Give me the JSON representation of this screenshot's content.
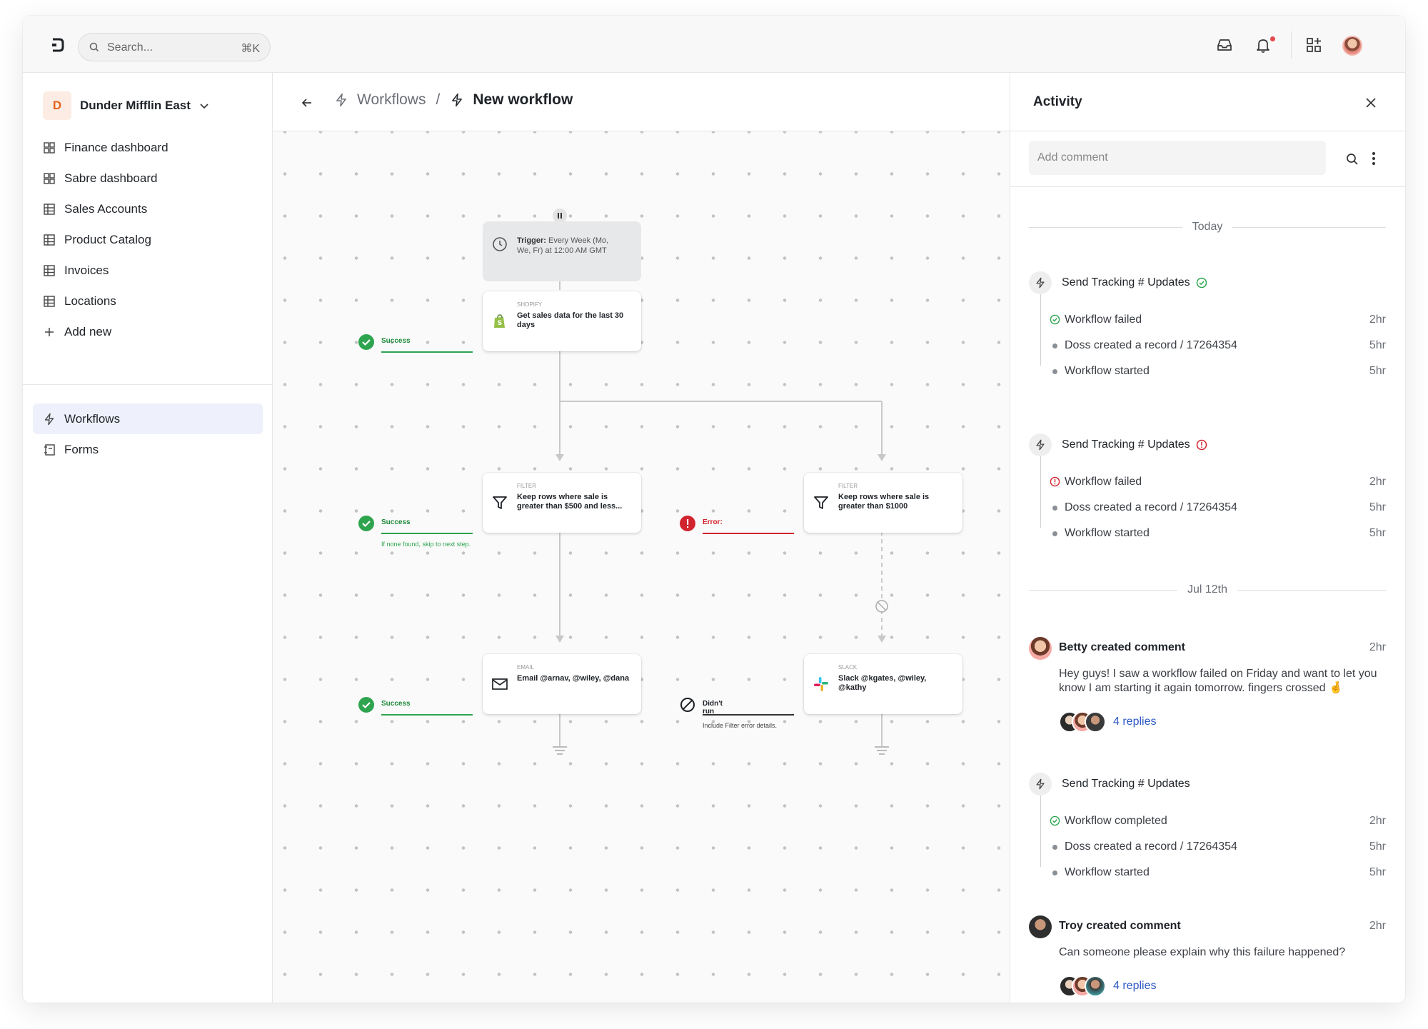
{
  "topbar": {
    "search_placeholder": "Search...",
    "search_shortcut": "⌘K"
  },
  "sidebar": {
    "org_initial": "D",
    "org_name": "Dunder Mifflin East",
    "items": [
      {
        "label": "Finance dashboard",
        "icon": "dashboard-icon"
      },
      {
        "label": "Sabre dashboard",
        "icon": "dashboard-icon"
      },
      {
        "label": "Sales Accounts",
        "icon": "table-icon"
      },
      {
        "label": "Product Catalog",
        "icon": "table-icon"
      },
      {
        "label": "Invoices",
        "icon": "table-icon"
      },
      {
        "label": "Locations",
        "icon": "table-icon"
      },
      {
        "label": "Add new",
        "icon": "plus-icon"
      }
    ],
    "sections": [
      {
        "label": "Workflows",
        "icon": "bolt-icon",
        "active": true
      },
      {
        "label": "Forms",
        "icon": "form-icon",
        "active": false
      }
    ]
  },
  "main": {
    "breadcrumb_parent": "Workflows",
    "breadcrumb_separator": "/",
    "breadcrumb_current": "New workflow",
    "nodes": {
      "trigger": {
        "label": "Trigger:",
        "text": "Every Week (Mo, We, Fr)  at 12:00 AM GMT"
      },
      "shopify": {
        "category": "SHOPIFY",
        "text": "Get sales data for the last 30 days"
      },
      "filter_left": {
        "category": "FILTER",
        "text": "Keep rows where sale is greater than $500 and less..."
      },
      "filter_right": {
        "category": "FILTER",
        "text": "Keep rows where sale is greater than $1000"
      },
      "email": {
        "category": "EMAIL",
        "text": "Email @arnav, @wiley, @dana"
      },
      "slack": {
        "category": "SLACK",
        "text": "Slack @kgates, @wiley, @kathy"
      }
    },
    "statuses": {
      "s1": {
        "label": "Success"
      },
      "s2": {
        "label": "Success",
        "note": "If none found, skip to next step."
      },
      "s3": {
        "label": "Success"
      },
      "err": {
        "label": "Error:"
      },
      "skip": {
        "label": "Didn't run",
        "note": "Include Filter error details."
      }
    }
  },
  "activity": {
    "title": "Activity",
    "comment_placeholder": "Add comment",
    "day_today": "Today",
    "day_jul": "Jul 12th",
    "groups": [
      {
        "title": "Send Tracking # Updates",
        "status": "success",
        "events": [
          {
            "text": "Workflow failed",
            "time": "2hr"
          },
          {
            "text": "Doss created a record /  17264354",
            "time": "5hr"
          },
          {
            "text": "Workflow started",
            "time": "5hr"
          }
        ]
      },
      {
        "title": "Send Tracking # Updates",
        "status": "error",
        "events": [
          {
            "text": "Workflow failed",
            "time": "2hr"
          },
          {
            "text": "Doss created a record /  17264354",
            "time": "5hr"
          },
          {
            "text": "Workflow started",
            "time": "5hr"
          }
        ]
      },
      {
        "title": "Send Tracking # Updates",
        "status": "none",
        "events": [
          {
            "text": "Workflow completed",
            "time": "2hr"
          },
          {
            "text": "Doss created a record /  17264354",
            "time": "5hr"
          },
          {
            "text": "Workflow started",
            "time": "5hr"
          }
        ]
      }
    ],
    "comments": [
      {
        "author": "Betty created comment",
        "time": "2hr",
        "body": "Hey guys! I saw a workflow failed on Friday and want to let you know I am starting it again tomorrow. fingers crossed 🤞",
        "replies": "4 replies"
      },
      {
        "author": "Troy created comment",
        "time": "2hr",
        "body": "Can someone please explain why this failure happened?",
        "replies": "4 replies"
      }
    ]
  },
  "colors": {
    "accent": "#2f59c4",
    "success": "#2ea44f",
    "error": "#d1242f",
    "org_badge": "#e4611b"
  }
}
